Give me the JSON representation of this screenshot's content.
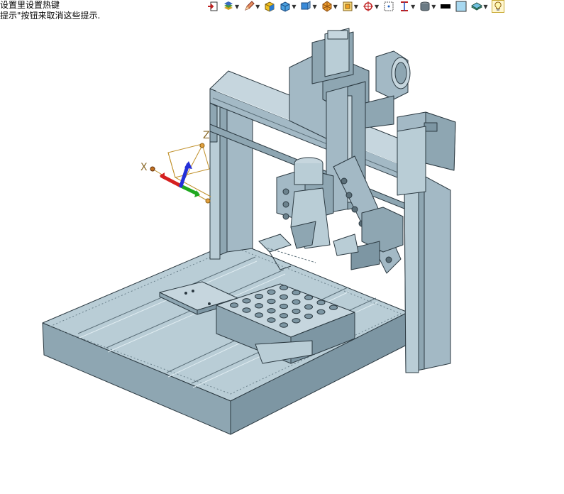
{
  "hints": {
    "line1": "设置里设置热键",
    "line2": "提示\"按钮来取消这些提示."
  },
  "toolbar": {
    "buttons": [
      {
        "icon": "import-icon",
        "has_menu": false
      },
      {
        "icon": "layer-icon",
        "has_menu": true
      },
      {
        "icon": "pencil-icon",
        "has_menu": true
      },
      {
        "icon": "box-yellow-icon",
        "has_menu": false
      },
      {
        "icon": "cube-shade-icon",
        "has_menu": true
      },
      {
        "icon": "cube-view-icon",
        "has_menu": true
      },
      {
        "icon": "render-icon",
        "has_menu": true
      },
      {
        "icon": "zoom-fit-icon",
        "has_menu": true
      },
      {
        "icon": "pan-icon",
        "has_menu": true
      },
      {
        "icon": "select-icon",
        "has_menu": false
      },
      {
        "icon": "section-icon",
        "has_menu": true
      },
      {
        "icon": "cylinder-icon",
        "has_menu": true
      },
      {
        "icon": "color-black-icon",
        "has_menu": false
      },
      {
        "icon": "color-box-icon",
        "has_menu": false
      },
      {
        "icon": "material-icon",
        "has_menu": true
      },
      {
        "icon": "lightbulb-icon",
        "has_menu": false
      }
    ]
  },
  "axes": {
    "x_label": "X",
    "z_label": "Z"
  },
  "colors": {
    "model": "#a3b9c5",
    "model_dark": "#7f97a4",
    "model_light": "#c6d6de",
    "edge": "#2c3a42",
    "axis_x": "#d52020",
    "axis_y": "#1fa81f",
    "axis_z": "#2430d8",
    "axis_frame": "#c0902a"
  }
}
